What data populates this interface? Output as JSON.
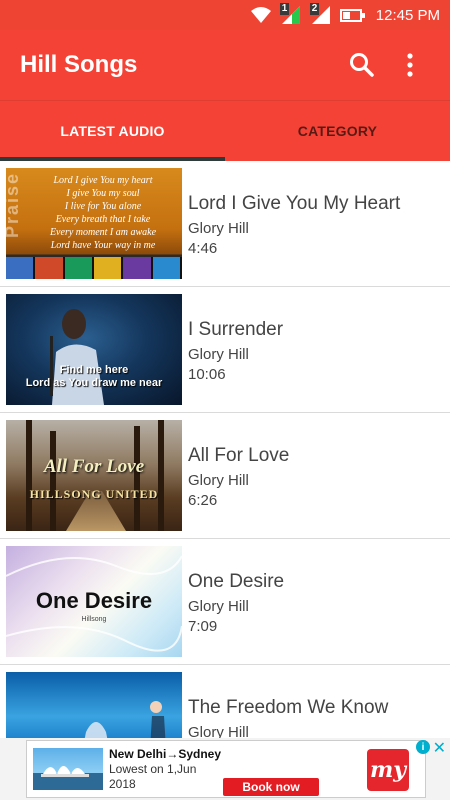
{
  "status_bar": {
    "time": "12:45 PM",
    "sim1": "1",
    "sim2": "2",
    "battery_level": 0.45
  },
  "app_bar": {
    "title": "Hill Songs"
  },
  "tabs": [
    {
      "label": "LATEST AUDIO",
      "active": true
    },
    {
      "label": "CATEGORY",
      "active": false
    }
  ],
  "songs": [
    {
      "title": "Lord I Give You My Heart",
      "artist": "Glory Hill",
      "duration": "4:46",
      "thumb_lyrics": [
        "Lord I give You my heart",
        "I give You my soul",
        "I live for You alone",
        "Every breath that I take",
        "Every moment I am awake",
        "Lord have Your way in me"
      ],
      "thumb_side_text": "Praise"
    },
    {
      "title": "I Surrender",
      "artist": "Glory Hill",
      "duration": "10:06",
      "thumb_lyrics": [
        "Find me here",
        "Lord as You draw me near"
      ]
    },
    {
      "title": "All For Love",
      "artist": "Glory Hill",
      "duration": "6:26",
      "thumb_title": "All For Love",
      "thumb_subtitle": "HILLSONG UNITED"
    },
    {
      "title": "One Desire",
      "artist": "Glory Hill",
      "duration": "7:09",
      "thumb_title": "One Desire",
      "thumb_subtitle": "Hillsong"
    },
    {
      "title": "The Freedom We Know",
      "artist": "Glory Hill",
      "duration": ""
    }
  ],
  "ad": {
    "route": "New Delhi→Sydney",
    "line2": "Lowest on 1,Jun",
    "line3": "2018",
    "cta": "Book now",
    "logo": "my",
    "info": "i",
    "close": "✕"
  },
  "colors": {
    "primary": "#f44336",
    "status_bar": "#ee4434",
    "indicator": "#2e3b3a",
    "ad_cta": "#e31b23"
  }
}
